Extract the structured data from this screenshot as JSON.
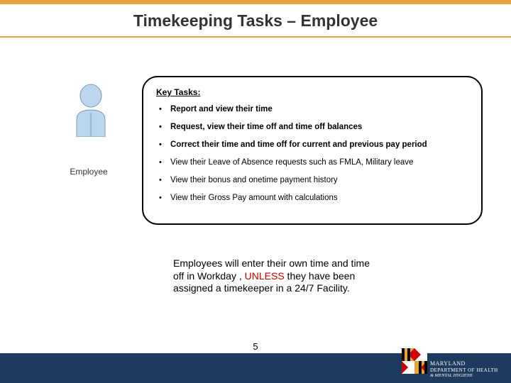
{
  "title": "Timekeeping Tasks – Employee",
  "employee_label": "Employee",
  "tasks": {
    "heading": "Key Tasks:",
    "items": [
      {
        "text": "Report and view their time",
        "bold": true
      },
      {
        "text": "Request, view their time off and time off balances",
        "bold": true
      },
      {
        "text": "Correct their time and time off for current and previous pay period",
        "bold": true
      },
      {
        "text": "View their Leave of Absence requests such as FMLA, Military leave",
        "bold": false
      },
      {
        "text": "View their bonus and onetime payment history",
        "bold": false
      },
      {
        "text": "View their Gross Pay amount with calculations",
        "bold": false
      }
    ]
  },
  "note": {
    "pre": "Employees will enter their own time and time off in Workday , ",
    "highlight": "UNLESS",
    "post": " they have been assigned a timekeeper in a 24/7 Facility."
  },
  "page_number": "5",
  "dept": {
    "line1": "MARYLAND",
    "line2": "DEPARTMENT OF HEALTH",
    "line3": "& MENTAL HYGIENE"
  }
}
